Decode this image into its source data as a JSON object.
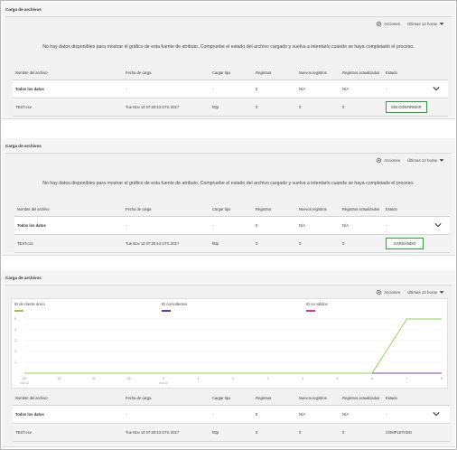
{
  "panels": [
    {
      "title": "Carga de archivos",
      "actions_label": "Acciones",
      "time_range": "Últimas 12 horas",
      "no_data_message": "No hay datos disponibles para mostrar el gráfico de esta fuente de atributo. Compruebe el estado del archivo cargado y vuelva a intentarlo cuando se haya completado el proceso.",
      "columns": [
        "Nombre del archivo",
        "Fecha de carga",
        "Cargar tipo",
        "Registros",
        "Nuevos registros",
        "Registros actualizados",
        "Estado"
      ],
      "total_row": [
        "Todos los datos",
        "-",
        "-",
        "0",
        "N/A",
        "N/A",
        "-"
      ],
      "file_row": [
        "TEST.csv",
        "Tue Nov 14 07:20:43 UTC 2017",
        "http",
        "0",
        "0",
        "0",
        "SIN CONFIRMAR"
      ]
    },
    {
      "title": "Carga de archivos",
      "actions_label": "Acciones",
      "time_range": "Últimas 12 horas",
      "no_data_message": "No hay datos disponibles para mostrar el gráfico de esta fuente de atributo. Compruebe el estado del archivo cargado y vuelva a intentarlo cuando se haya completado el proceso.",
      "columns": [
        "Nombre del archivo",
        "Fecha de carga",
        "Cargar tipo",
        "Registros",
        "Nuevos registros",
        "Registros actualizados",
        "Estado"
      ],
      "total_row": [
        "Todos los datos",
        "-",
        "-",
        "0",
        "N/A",
        "N/A",
        "-"
      ],
      "file_row": [
        "TEST.csv",
        "Tue Nov 14 07:20:43 UTC 2017",
        "http",
        "0",
        "0",
        "0",
        "CARGANDO"
      ]
    },
    {
      "title": "Carga de archivos",
      "actions_label": "Acciones",
      "time_range": "Últimas 12 horas",
      "columns": [
        "Nombre del archivo",
        "Fecha de carga",
        "Cargar tipo",
        "Registros",
        "Nuevos registros",
        "Registros actualizados",
        "Estado"
      ],
      "total_row": [
        "Todos los datos",
        "-",
        "-",
        "5",
        "N/A",
        "N/A",
        "-"
      ],
      "file_row": [
        "TEST.csv",
        "Tue Nov 14 07:20:43 UTC 2017",
        "http",
        "5",
        "0",
        "0",
        "COMPLETADO"
      ]
    }
  ],
  "colors": {
    "status_highlight": "#2e9e3b",
    "series_green": "#8fd14f",
    "series_purple": "#5b3fa0",
    "series_pink": "#e0368a"
  },
  "chart_data": {
    "type": "line",
    "x": [
      "20",
      "21",
      "22",
      "23",
      "0",
      "1",
      "2",
      "3",
      "4",
      "5",
      "6",
      "7",
      "8"
    ],
    "x_sublabels": [
      "nov 13",
      "",
      "",
      "",
      "nov 14",
      "",
      "",
      "",
      "",
      "",
      "",
      "",
      ""
    ],
    "ylim": [
      0,
      5
    ],
    "yticks": [
      "1",
      "2",
      "3",
      "4",
      "5"
    ],
    "series": [
      {
        "name": "ID de cliente único",
        "color": "#8fd14f",
        "values": [
          0,
          0,
          0,
          0,
          0,
          0,
          0,
          0,
          0,
          0,
          0,
          5,
          5
        ]
      },
      {
        "name": "ID coincidentes",
        "color": "#5b3fa0",
        "values": [
          0,
          0,
          0,
          0,
          0,
          0,
          0,
          0,
          0,
          0,
          0,
          0,
          0
        ]
      },
      {
        "name": "ID no válidos",
        "color": "#e0368a",
        "values": [
          0,
          0,
          0,
          0,
          0,
          0,
          0,
          0,
          0,
          0,
          0,
          0,
          0
        ]
      }
    ]
  }
}
